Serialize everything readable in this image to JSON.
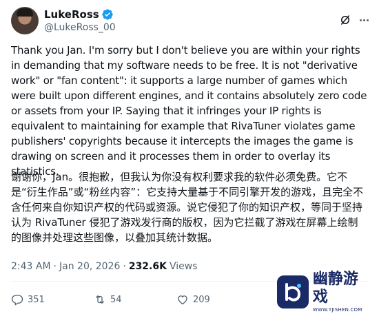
{
  "author": {
    "display_name": "LukeRoss",
    "handle": "@LukeRoss_00",
    "verified": true
  },
  "tweet": {
    "text_en": "Thank you Jan. I'm sorry but I don't believe you are within your rights in demanding that my software needs to be free. It is not \"derivative work\" or \"fan content\": it supports a large number of games which were built upon different engines, and it contains absolutely zero code or assets from your IP. Saying that it infringes your IP rights is equivalent to maintaining for example that RivaTuner violates game publishers' copyrights because it intercepts the images the game is drawing on screen and it processes them in order to overlay its statistics.",
    "text_zh": "谢谢你，Jan。很抱歉，但我认为你没有权利要求我的软件必须免费。它不是“衍生作品”或“粉丝内容”：它支持大量基于不同引擎开发的游戏，且完全不含任何来自你知识产权的代码或资源。说它侵犯了你的知识产权，等同于坚持认为 RivaTuner 侵犯了游戏发行商的版权，因为它拦截了游戏在屏幕上绘制的图像并处理这些图像，以叠加其统计数据。"
  },
  "meta": {
    "time": "2:43 AM",
    "separator": "·",
    "date": "Jan 20, 2026",
    "views_count": "232.6K",
    "views_label": "Views"
  },
  "actions": {
    "replies": "351",
    "reposts": "54",
    "likes": "209"
  },
  "watermark": {
    "title": "幽静游戏",
    "url": "WWW.YJISHEN.COM"
  },
  "colors": {
    "text": "#0f1419",
    "secondary": "#536471",
    "verified": "#1d9bf0",
    "watermark": "#1a2a66"
  },
  "icons": [
    "verified-badge-icon",
    "grok-icon",
    "more-icon",
    "reply-icon",
    "repost-icon",
    "like-icon"
  ]
}
